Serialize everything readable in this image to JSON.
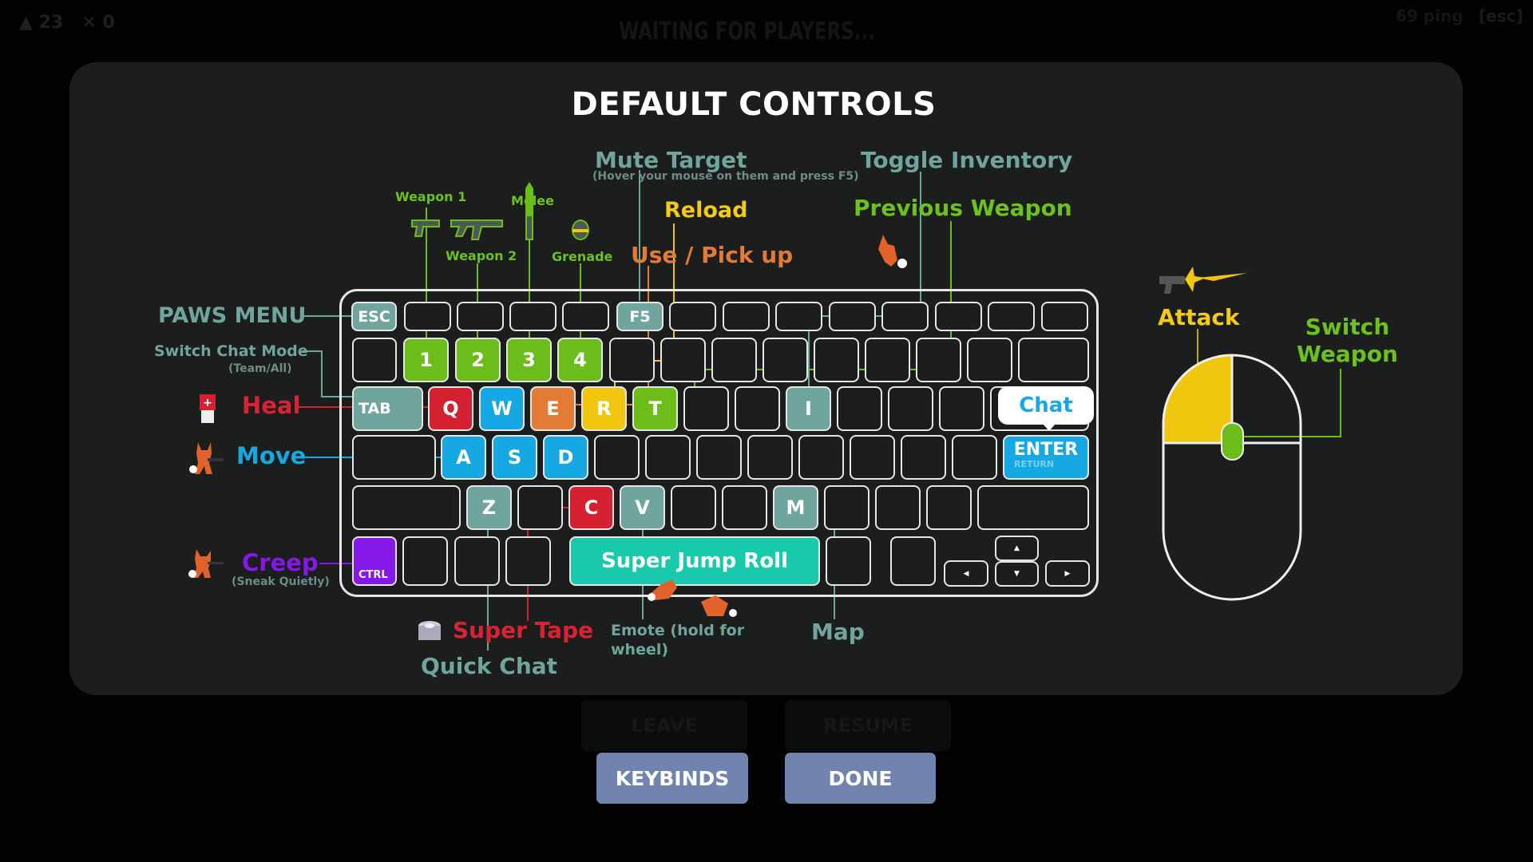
{
  "hud": {
    "title": "WAITING FOR PLAYERS...",
    "players_count": "23",
    "kills_count": "0",
    "ping": "69 ping",
    "esc_hint": "[esc]",
    "bg_buttons": {
      "leave": "LEAVE",
      "resume": "RESUME"
    }
  },
  "panel": {
    "title": "DEFAULT CONTROLS",
    "labels": {
      "paws_menu": "PAWS MENU",
      "switch_chat_mode": "Switch Chat Mode",
      "switch_chat_mode_sub": "(Team/All)",
      "heal": "Heal",
      "move": "Move",
      "creep": "Creep",
      "creep_sub": "(Sneak Quietly)",
      "weapon1": "Weapon 1",
      "weapon2": "Weapon 2",
      "melee": "Melee",
      "grenade": "Grenade",
      "mute_target": "Mute Target",
      "mute_target_sub": "(Hover your mouse on them and press F5)",
      "reload": "Reload",
      "use_pickup": "Use / Pick up",
      "toggle_inventory": "Toggle Inventory",
      "previous_weapon": "Previous Weapon",
      "attack": "Attack",
      "switch_weapon_1": "Switch",
      "switch_weapon_2": "Weapon",
      "super_tape": "Super Tape",
      "quick_chat": "Quick Chat",
      "emote_1": "Emote (hold for",
      "emote_2": "wheel)",
      "map": "Map",
      "chat": "Chat"
    },
    "keys": {
      "esc": "ESC",
      "f5": "F5",
      "k1": "1",
      "k2": "2",
      "k3": "3",
      "k4": "4",
      "tab": "TAB",
      "q": "Q",
      "w": "W",
      "e": "E",
      "r": "R",
      "t": "T",
      "i": "I",
      "a": "A",
      "s": "S",
      "d": "D",
      "enter": "ENTER",
      "enter_sub": "RETURN",
      "z": "Z",
      "c": "C",
      "v": "V",
      "m": "M",
      "ctrl": "CTRL",
      "space": "Super Jump Roll",
      "up": "▲",
      "down": "▼",
      "left": "◀",
      "right": "▶"
    },
    "colors": {
      "teal": "#6fa59c",
      "green": "#6cbd1a",
      "red": "#d42030",
      "blue": "#15a8e2",
      "orange": "#e37b34",
      "yellow": "#f0c60f",
      "purple": "#8318e8",
      "cyan": "#18c9ac"
    }
  },
  "buttons": {
    "keybinds": "KEYBINDS",
    "done": "DONE"
  }
}
